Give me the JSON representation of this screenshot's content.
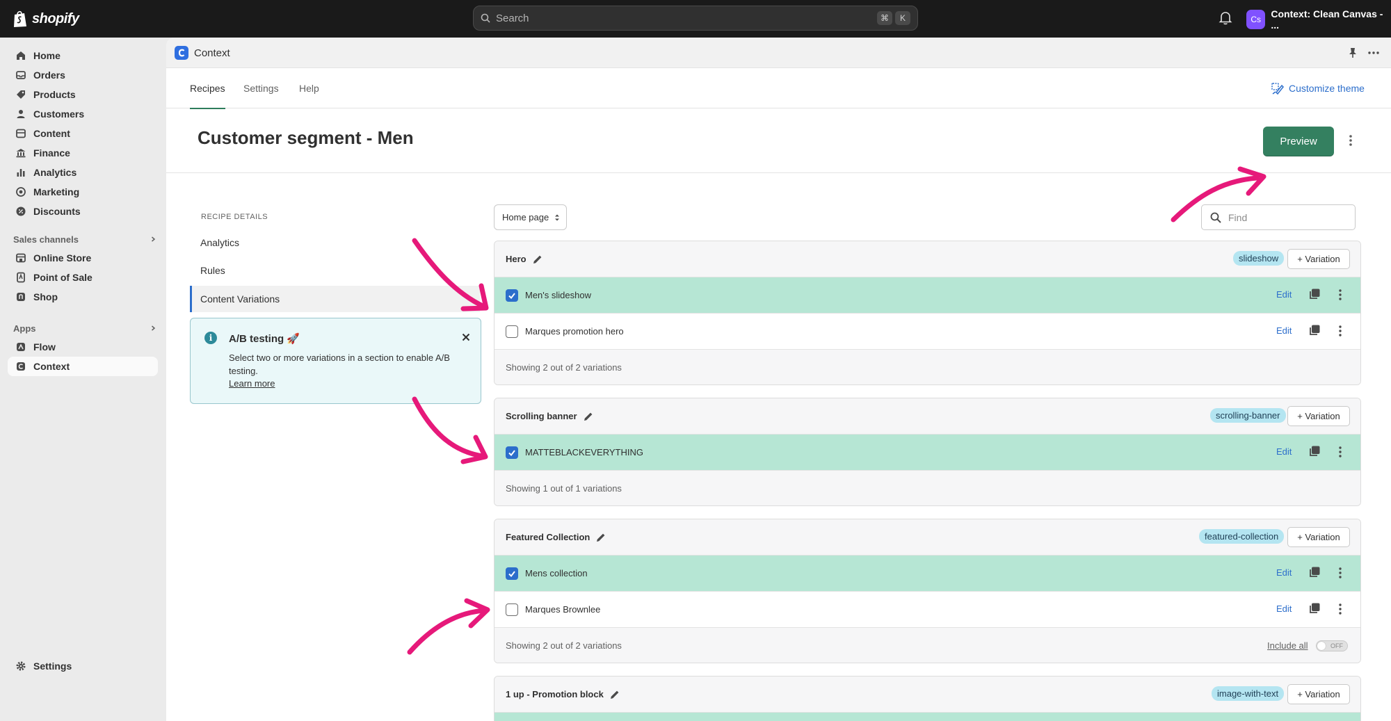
{
  "topbar": {
    "logo_text": "shopify",
    "search_placeholder": "Search",
    "shortcut_keys": [
      "⌘",
      "K"
    ],
    "store_initials": "Cs",
    "store_name": "Context: Clean Canvas - ..."
  },
  "sidebar": {
    "items": [
      {
        "label": "Home",
        "icon": "home-icon"
      },
      {
        "label": "Orders",
        "icon": "inbox-icon"
      },
      {
        "label": "Products",
        "icon": "tag-icon"
      },
      {
        "label": "Customers",
        "icon": "person-icon"
      },
      {
        "label": "Content",
        "icon": "content-icon"
      },
      {
        "label": "Finance",
        "icon": "bank-icon"
      },
      {
        "label": "Analytics",
        "icon": "bar-chart-icon"
      },
      {
        "label": "Marketing",
        "icon": "target-icon"
      },
      {
        "label": "Discounts",
        "icon": "discount-icon"
      }
    ],
    "sales_channels_label": "Sales channels",
    "sales_channels": [
      {
        "label": "Online Store",
        "icon": "store-icon"
      },
      {
        "label": "Point of Sale",
        "icon": "pos-icon"
      },
      {
        "label": "Shop",
        "icon": "shop-icon"
      }
    ],
    "apps_label": "Apps",
    "apps": [
      {
        "label": "Flow",
        "icon": "flow-icon"
      },
      {
        "label": "Context",
        "icon": "context-icon"
      }
    ],
    "settings_label": "Settings"
  },
  "app": {
    "name": "Context",
    "tabs": [
      "Recipes",
      "Settings",
      "Help"
    ],
    "customize_label": "Customize theme"
  },
  "page": {
    "title": "Customer segment - Men",
    "preview_label": "Preview"
  },
  "recipe_details": {
    "heading": "RECIPE DETAILS",
    "items": [
      "Analytics",
      "Rules",
      "Content Variations"
    ]
  },
  "ab_testing": {
    "title": "A/B testing 🚀",
    "text": "Select two or more variations in a section to enable A/B testing.",
    "link": "Learn more"
  },
  "controls": {
    "page_select": "Home page",
    "find_placeholder": "Find"
  },
  "sections": [
    {
      "name": "Hero",
      "tag": "slideshow",
      "variation_label": "+ Variation",
      "rows": [
        {
          "label": "Men's slideshow",
          "checked": true
        },
        {
          "label": "Marques promotion hero",
          "checked": false
        }
      ],
      "footer": "Showing 2 out of 2 variations"
    },
    {
      "name": "Scrolling banner",
      "tag": "scrolling-banner",
      "variation_label": "+ Variation",
      "rows": [
        {
          "label": "MATTEBLACKEVERYTHING",
          "checked": true
        }
      ],
      "footer": "Showing 1 out of 1 variations"
    },
    {
      "name": "Featured Collection",
      "tag": "featured-collection",
      "variation_label": "+ Variation",
      "rows": [
        {
          "label": "Mens collection",
          "checked": true
        },
        {
          "label": "Marques Brownlee",
          "checked": false
        }
      ],
      "footer": "Showing 2 out of 2 variations",
      "include_all_label": "Include all",
      "toggle_label": "OFF"
    },
    {
      "name": "1 up - Promotion block",
      "tag": "image-with-text",
      "variation_label": "+ Variation",
      "rows": [],
      "footer": ""
    }
  ],
  "row_edit_label": "Edit",
  "colors": {
    "accent_green": "#348060",
    "selected_row": "#b6e6d4",
    "link_blue": "#2c6ecb",
    "annotation_arrow": "#e6197a",
    "tag_bg": "#b4e5f1"
  }
}
